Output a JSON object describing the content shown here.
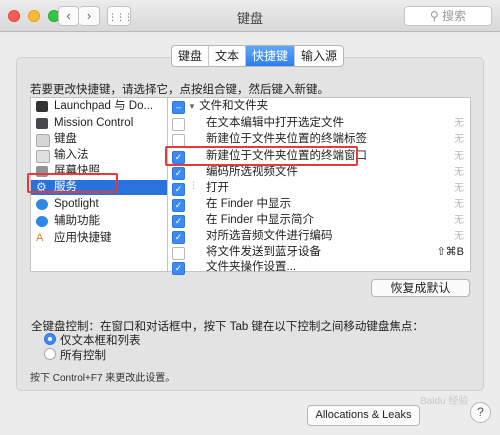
{
  "window": {
    "title": "键盘",
    "search_placeholder": "搜索",
    "search_icon": "magnifier-icon"
  },
  "tabs": [
    {
      "label": "键盘"
    },
    {
      "label": "文本"
    },
    {
      "label": "快捷键",
      "active": true
    },
    {
      "label": "输入源"
    }
  ],
  "hint": "若要更改快捷键，请选择它，点按组合键，然后键入新键。",
  "categories": [
    {
      "label": "Launchpad 与 Do...",
      "icon": "launchpad-icon"
    },
    {
      "label": "Mission Control",
      "icon": "mission-control-icon"
    },
    {
      "label": "键盘",
      "icon": "keyboard-icon"
    },
    {
      "label": "输入法",
      "icon": "input-icon"
    },
    {
      "label": "屏幕快照",
      "icon": "screenshot-icon"
    },
    {
      "label": "服务",
      "icon": "services-gear-icon",
      "selected": true
    },
    {
      "label": "Spotlight",
      "icon": "spotlight-icon"
    },
    {
      "label": "辅助功能",
      "icon": "accessibility-icon"
    },
    {
      "label": "应用快捷键",
      "icon": "app-shortcuts-icon"
    }
  ],
  "services": {
    "group_label": "文件和文件夹",
    "items": [
      {
        "label": "在文本编辑中打开选定文件",
        "checked": false,
        "key": "无"
      },
      {
        "label": "新建位于文件夹位置的终端标签",
        "checked": false,
        "key": "无"
      },
      {
        "label": "新建位于文件夹位置的终端窗口",
        "checked": true,
        "key": "无"
      },
      {
        "label": "编码所选视频文件",
        "checked": true,
        "key": "无"
      },
      {
        "label": "打开",
        "checked": true,
        "key": "无"
      },
      {
        "label": "在 Finder 中显示",
        "checked": true,
        "key": "无"
      },
      {
        "label": "在 Finder 中显示简介",
        "checked": true,
        "key": "无"
      },
      {
        "label": "对所选音频文件进行编码",
        "checked": true,
        "key": "无"
      },
      {
        "label": "将文件发送到蓝牙设备",
        "checked": false,
        "key": "⇧⌘B"
      },
      {
        "label": "文件夹操作设置...",
        "checked": true,
        "key": ""
      }
    ]
  },
  "restore_button": "恢复成默认",
  "keyboard_control": {
    "title": "全键盘控制：在窗口和对话框中，按下 Tab 键在以下控制之间移动键盘焦点：",
    "options": [
      {
        "label": "仅文本框和列表",
        "selected": true
      },
      {
        "label": "所有控制",
        "selected": false
      }
    ],
    "note": "按下 Control+F7 来更改此设置。"
  },
  "allocations_button": "Allocations & Leaks",
  "help_button": "?",
  "watermark": "Baidu 经验",
  "colors": {
    "accent": "#2A72DB",
    "highlight_box": "#E23B3B"
  }
}
